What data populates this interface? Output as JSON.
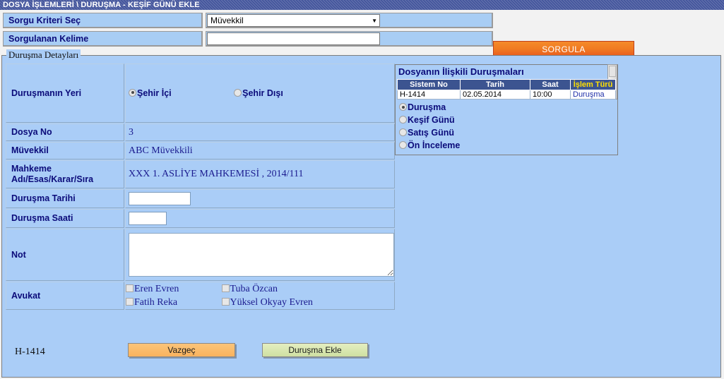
{
  "window": {
    "title": "DOSYA İŞLEMLERİ \\ DURUŞMA - KEŞİF GÜNÜ EKLE"
  },
  "search": {
    "criteria_label": "Sorgu Kriteri Seç",
    "criteria_value": "Müvekkil",
    "criteria_arrow": "▼",
    "keyword_label": "Sorgulanan Kelime",
    "keyword_value": "",
    "keyword_placeholder": "",
    "submit_label": "SORGULA",
    "submit_color": "#ee6a21"
  },
  "details": {
    "legend": "Duruşma Detayları",
    "rows": {
      "location_label": "Duruşmanın Yeri",
      "location_options": [
        {
          "label": "Şehir İçi",
          "selected": true
        },
        {
          "label": "Şehir Dışı",
          "selected": false
        }
      ],
      "file_no_label": "Dosya No",
      "file_no_value": "3",
      "client_label": "Müvekkil",
      "client_value": "ABC Müvekkili",
      "court_label": "Mahkeme Adı/Esas/Karar/Sıra",
      "court_value": "XXX 1. ASLİYE MAHKEMESİ , 2014/111",
      "hearing_date_label": "Duruşma Tarihi",
      "hearing_date_value": "",
      "hearing_time_label": "Duruşma Saati",
      "hearing_time_value": "",
      "note_label": "Not",
      "note_value": "",
      "lawyer_label": "Avukat",
      "lawyers": [
        {
          "name": "Eren Evren",
          "checked": false
        },
        {
          "name": "Tuba Özcan",
          "checked": false
        },
        {
          "name": "Fatih Reka",
          "checked": false
        },
        {
          "name": "Yüksel Okyay Evren",
          "checked": false
        }
      ]
    }
  },
  "related": {
    "panel_title": "Dosyanın İlişkili Duruşmaları",
    "columns": [
      "Sistem No",
      "Tarih",
      "Saat",
      "İşlem Türü"
    ],
    "accent_column_color": "#ffe000",
    "rows": [
      {
        "sistem_no": "H-1414",
        "tarih": "02.05.2014",
        "saat": "10:00",
        "islem_turu": "Duruşma"
      }
    ],
    "types": [
      {
        "label": "Duruşma",
        "selected": true
      },
      {
        "label": "Keşif Günü",
        "selected": false
      },
      {
        "label": "Satış Günü",
        "selected": false
      },
      {
        "label": "Ön İnceleme",
        "selected": false
      }
    ]
  },
  "footer": {
    "reference_id": "H-1414",
    "cancel_label": "Vazgeç",
    "add_label": "Duruşma Ekle"
  }
}
